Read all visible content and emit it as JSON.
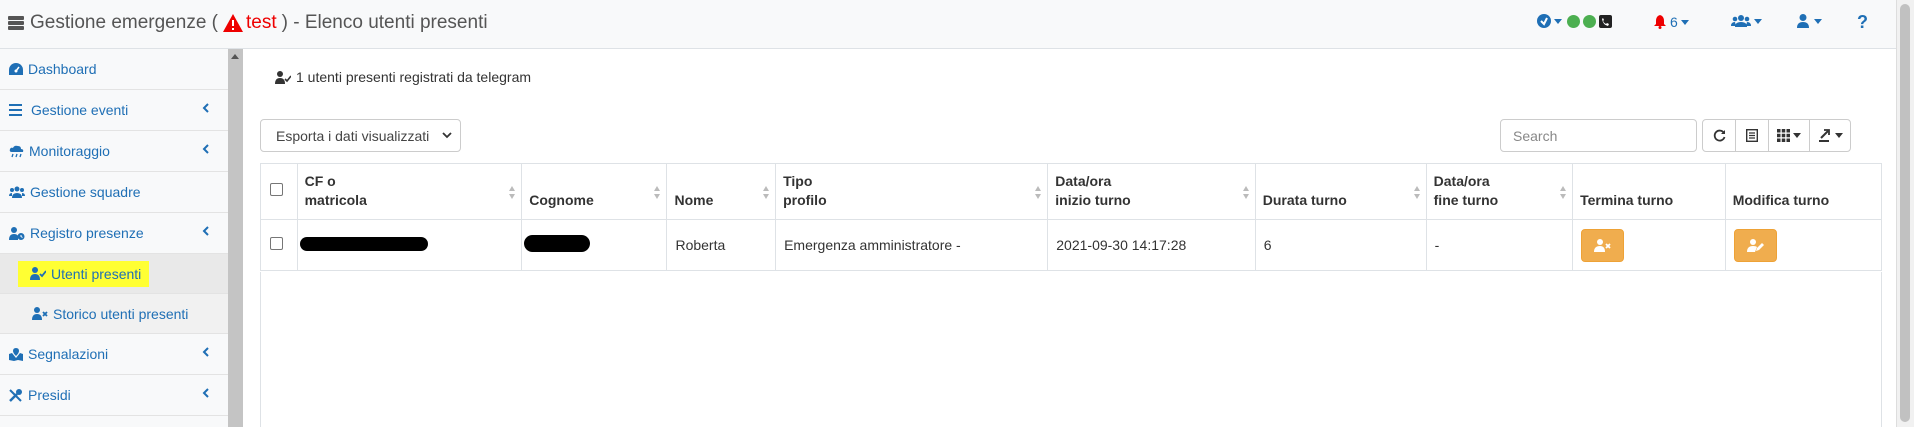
{
  "header": {
    "title_prefix": "Gestione emergenze (",
    "env_label": "test",
    "title_suffix": ") - Elenco utenti presenti",
    "notification_count": "6",
    "help_label": "?"
  },
  "sidebar": {
    "items": [
      {
        "label": "Dashboard",
        "icon": "dashboard-icon"
      },
      {
        "label": "Gestione eventi",
        "icon": "bars-icon"
      },
      {
        "label": "Monitoraggio",
        "icon": "cloud-rain-icon"
      },
      {
        "label": "Gestione squadre",
        "icon": "users-icon"
      },
      {
        "label": "Registro presenze",
        "icon": "user-clock-icon"
      },
      {
        "label": "Utenti presenti",
        "icon": "user-check-icon"
      },
      {
        "label": "Storico utenti presenti",
        "icon": "user-times-icon"
      },
      {
        "label": "Segnalazioni",
        "icon": "map-marked-icon"
      },
      {
        "label": "Presidi",
        "icon": "tools-icon"
      }
    ]
  },
  "main": {
    "summary": "1 utenti presenti registrati da telegram",
    "export_label": "Esporta i dati visualizzati",
    "search_placeholder": "Search",
    "columns": [
      {
        "l1": "CF o",
        "l2": "matricola"
      },
      {
        "l1": "",
        "l2": "Cognome"
      },
      {
        "l1": "",
        "l2": "Nome"
      },
      {
        "l1": "Tipo",
        "l2": "profilo"
      },
      {
        "l1": "Data/ora",
        "l2": "inizio turno"
      },
      {
        "l1": "",
        "l2": "Durata turno"
      },
      {
        "l1": "Data/ora",
        "l2": "fine turno"
      },
      {
        "l1": "",
        "l2": "Termina turno"
      },
      {
        "l1": "",
        "l2": "Modifica turno"
      }
    ],
    "rows": [
      {
        "nome": "Roberta",
        "profilo": "Emergenza amministratore -",
        "inizio": "2021-09-30 14:17:28",
        "durata": "6",
        "fine": "-"
      }
    ]
  },
  "colors": {
    "accent": "#1f6fb5",
    "warning_button": "#f0ad4e",
    "status_green": "#4caf50",
    "highlight": "#ffff33",
    "env_red": "#e00000"
  }
}
